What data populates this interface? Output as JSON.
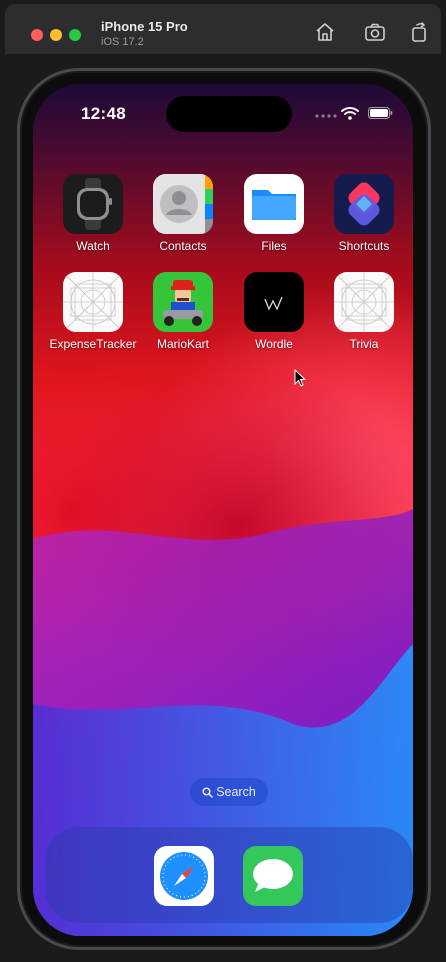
{
  "toolbar": {
    "device_name": "iPhone 15 Pro",
    "os_version": "iOS 17.2",
    "buttons": [
      "home-icon",
      "screenshot-icon",
      "rotate-icon"
    ]
  },
  "status_bar": {
    "time": "12:48"
  },
  "home_screen": {
    "apps": [
      {
        "label": "Watch",
        "icon": "watch-icon"
      },
      {
        "label": "Contacts",
        "icon": "contacts-icon"
      },
      {
        "label": "Files",
        "icon": "folder-icon"
      },
      {
        "label": "Shortcuts",
        "icon": "shortcuts-icon"
      },
      {
        "label": "ExpenseTracker",
        "icon": "placeholder-app-icon"
      },
      {
        "label": "MarioKart",
        "icon": "mario-kart-icon"
      },
      {
        "label": "Wordle",
        "icon": "wordle-icon"
      },
      {
        "label": "Trivia",
        "icon": "placeholder-app-icon"
      }
    ],
    "search_label": "Search"
  },
  "dock": {
    "apps": [
      {
        "name": "Safari",
        "icon": "safari-icon"
      },
      {
        "name": "Messages",
        "icon": "messages-icon"
      }
    ]
  }
}
